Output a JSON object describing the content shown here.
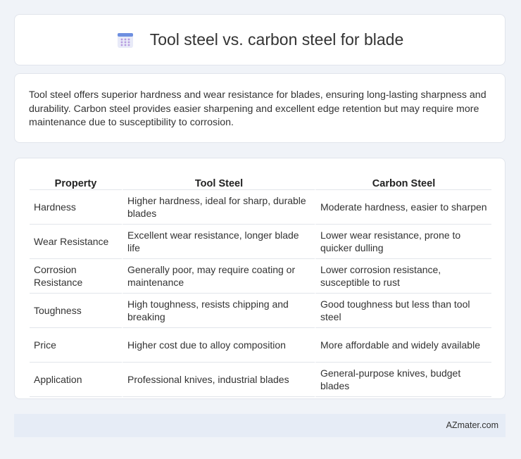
{
  "header": {
    "title": "Tool steel vs. carbon steel for blade",
    "icon": "calendar-icon"
  },
  "summary": {
    "text": "Tool steel offers superior hardness and wear resistance for blades, ensuring long-lasting sharpness and durability. Carbon steel provides easier sharpening and excellent edge retention but may require more maintenance due to susceptibility to corrosion."
  },
  "table": {
    "headers": [
      "Property",
      "Tool Steel",
      "Carbon Steel"
    ],
    "rows": [
      [
        "Hardness",
        "Higher hardness, ideal for sharp, durable blades",
        "Moderate hardness, easier to sharpen"
      ],
      [
        "Wear Resistance",
        "Excellent wear resistance, longer blade life",
        "Lower wear resistance, prone to quicker dulling"
      ],
      [
        "Corrosion Resistance",
        "Generally poor, may require coating or maintenance",
        "Lower corrosion resistance, susceptible to rust"
      ],
      [
        "Toughness",
        "High toughness, resists chipping and breaking",
        "Good toughness but less than tool steel"
      ],
      [
        "Price",
        "Higher cost due to alloy composition",
        "More affordable and widely available"
      ],
      [
        "Application",
        "Professional knives, industrial blades",
        "General-purpose knives, budget blades"
      ]
    ]
  },
  "footer": {
    "brand": "AZmater.com"
  }
}
